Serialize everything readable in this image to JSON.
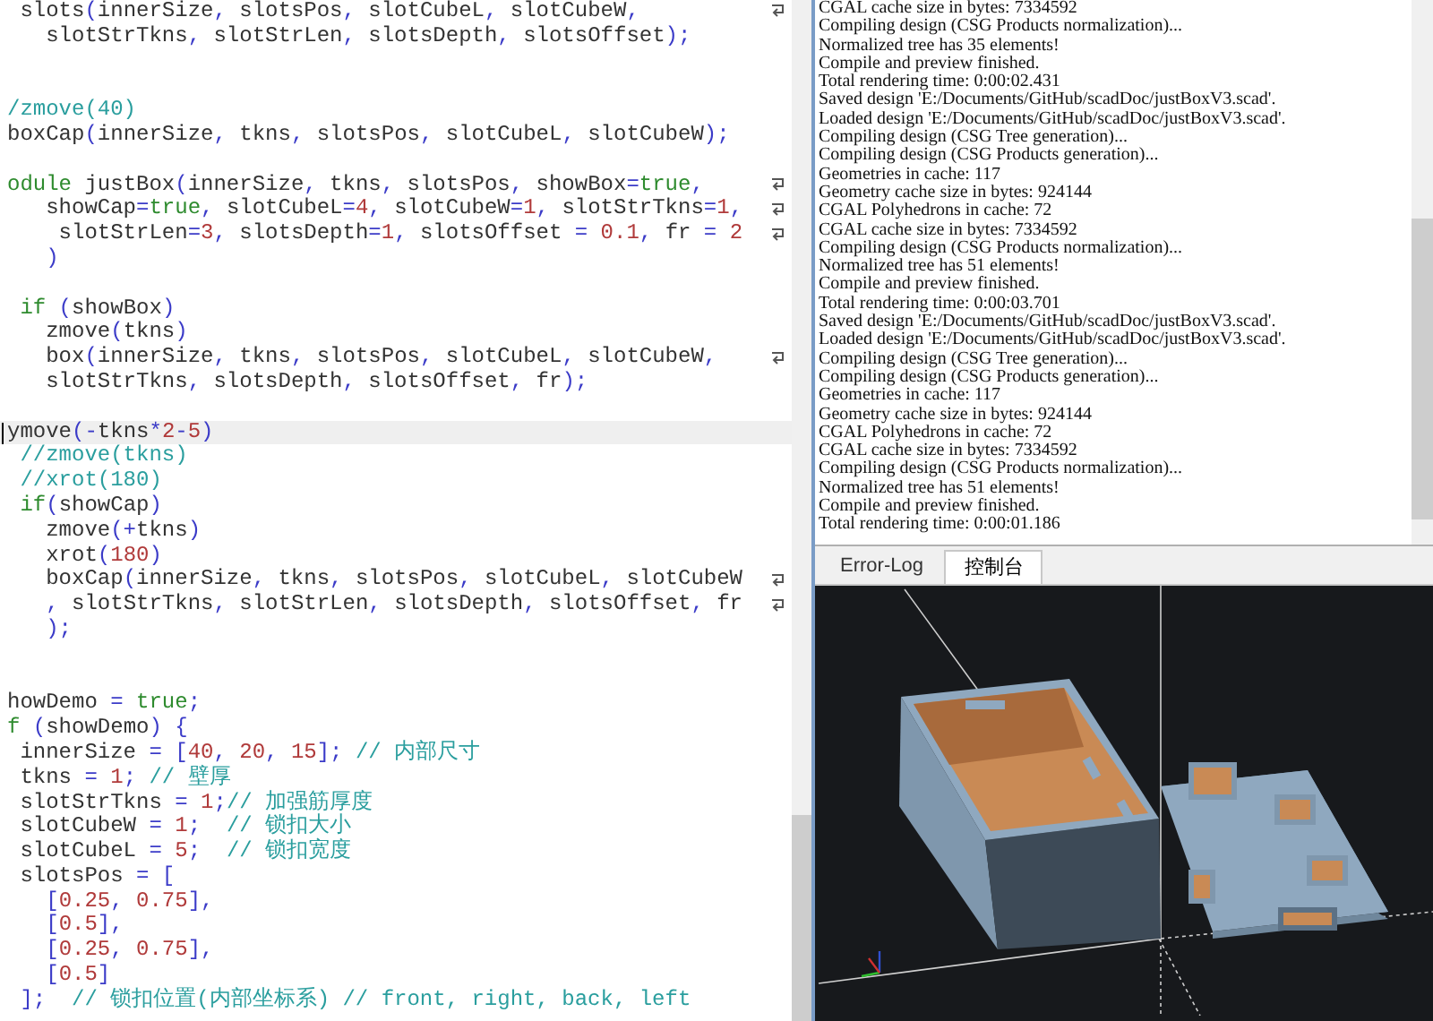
{
  "editor": {
    "lines": [
      {
        "wrapped": true,
        "current": false,
        "segs": [
          {
            "kind": "t",
            "text": " slots"
          },
          {
            "kind": "p",
            "text": "("
          },
          {
            "kind": "t",
            "text": "innerSize"
          },
          {
            "kind": "p",
            "text": ", "
          },
          {
            "kind": "t",
            "text": "slotsPos"
          },
          {
            "kind": "p",
            "text": ", "
          },
          {
            "kind": "t",
            "text": "slotCubeL"
          },
          {
            "kind": "p",
            "text": ", "
          },
          {
            "kind": "t",
            "text": "slotCubeW"
          },
          {
            "kind": "p",
            "text": ","
          }
        ]
      },
      {
        "wrapped": false,
        "current": false,
        "segs": [
          {
            "kind": "t",
            "text": "   slotStrTkns"
          },
          {
            "kind": "p",
            "text": ", "
          },
          {
            "kind": "t",
            "text": "slotStrLen"
          },
          {
            "kind": "p",
            "text": ", "
          },
          {
            "kind": "t",
            "text": "slotsDepth"
          },
          {
            "kind": "p",
            "text": ", "
          },
          {
            "kind": "t",
            "text": "slotsOffset"
          },
          {
            "kind": "p",
            "text": ");"
          }
        ]
      },
      {
        "wrapped": false,
        "current": false
      },
      {
        "wrapped": false,
        "current": false
      },
      {
        "wrapped": false,
        "current": false,
        "segs": [
          {
            "kind": "c",
            "text": "/zmove(40)"
          }
        ]
      },
      {
        "wrapped": false,
        "current": false,
        "segs": [
          {
            "kind": "t",
            "text": "boxCap"
          },
          {
            "kind": "p",
            "text": "("
          },
          {
            "kind": "t",
            "text": "innerSize"
          },
          {
            "kind": "p",
            "text": ", "
          },
          {
            "kind": "t",
            "text": "tkns"
          },
          {
            "kind": "p",
            "text": ", "
          },
          {
            "kind": "t",
            "text": "slotsPos"
          },
          {
            "kind": "p",
            "text": ", "
          },
          {
            "kind": "t",
            "text": "slotCubeL"
          },
          {
            "kind": "p",
            "text": ", "
          },
          {
            "kind": "t",
            "text": "slotCubeW"
          },
          {
            "kind": "p",
            "text": ");"
          }
        ]
      },
      {
        "wrapped": false,
        "current": false
      },
      {
        "wrapped": true,
        "current": false,
        "segs": [
          {
            "kind": "k",
            "text": "odule"
          },
          {
            "kind": "t",
            "text": " justBox"
          },
          {
            "kind": "p",
            "text": "("
          },
          {
            "kind": "t",
            "text": "innerSize"
          },
          {
            "kind": "p",
            "text": ", "
          },
          {
            "kind": "t",
            "text": "tkns"
          },
          {
            "kind": "p",
            "text": ", "
          },
          {
            "kind": "t",
            "text": "slotsPos"
          },
          {
            "kind": "p",
            "text": ", "
          },
          {
            "kind": "t",
            "text": "showBox"
          },
          {
            "kind": "p",
            "text": "="
          },
          {
            "kind": "k",
            "text": "true"
          },
          {
            "kind": "p",
            "text": ","
          }
        ]
      },
      {
        "wrapped": true,
        "current": false,
        "segs": [
          {
            "kind": "t",
            "text": "   showCap"
          },
          {
            "kind": "p",
            "text": "="
          },
          {
            "kind": "k",
            "text": "true"
          },
          {
            "kind": "p",
            "text": ", "
          },
          {
            "kind": "t",
            "text": "slotCubeL"
          },
          {
            "kind": "p",
            "text": "="
          },
          {
            "kind": "n",
            "text": "4"
          },
          {
            "kind": "p",
            "text": ", "
          },
          {
            "kind": "t",
            "text": "slotCubeW"
          },
          {
            "kind": "p",
            "text": "="
          },
          {
            "kind": "n",
            "text": "1"
          },
          {
            "kind": "p",
            "text": ", "
          },
          {
            "kind": "t",
            "text": "slotStrTkns"
          },
          {
            "kind": "p",
            "text": "="
          },
          {
            "kind": "n",
            "text": "1"
          },
          {
            "kind": "p",
            "text": ","
          }
        ]
      },
      {
        "wrapped": true,
        "current": false,
        "segs": [
          {
            "kind": "t",
            "text": "    slotStrLen"
          },
          {
            "kind": "p",
            "text": "="
          },
          {
            "kind": "n",
            "text": "3"
          },
          {
            "kind": "p",
            "text": ", "
          },
          {
            "kind": "t",
            "text": "slotsDepth"
          },
          {
            "kind": "p",
            "text": "="
          },
          {
            "kind": "n",
            "text": "1"
          },
          {
            "kind": "p",
            "text": ", "
          },
          {
            "kind": "t",
            "text": "slotsOffset "
          },
          {
            "kind": "p",
            "text": "= "
          },
          {
            "kind": "n",
            "text": "0.1"
          },
          {
            "kind": "p",
            "text": ", "
          },
          {
            "kind": "t",
            "text": "fr "
          },
          {
            "kind": "p",
            "text": "= "
          },
          {
            "kind": "n",
            "text": "2"
          }
        ]
      },
      {
        "wrapped": false,
        "current": false,
        "segs": [
          {
            "kind": "p",
            "text": "   )"
          }
        ]
      },
      {
        "wrapped": false,
        "current": false
      },
      {
        "wrapped": false,
        "current": false,
        "segs": [
          {
            "kind": "k",
            "text": " if"
          },
          {
            "kind": "p",
            "text": " ("
          },
          {
            "kind": "t",
            "text": "showBox"
          },
          {
            "kind": "p",
            "text": ")"
          }
        ]
      },
      {
        "wrapped": false,
        "current": false,
        "segs": [
          {
            "kind": "t",
            "text": "   zmove"
          },
          {
            "kind": "p",
            "text": "("
          },
          {
            "kind": "t",
            "text": "tkns"
          },
          {
            "kind": "p",
            "text": ")"
          }
        ]
      },
      {
        "wrapped": true,
        "current": false,
        "segs": [
          {
            "kind": "t",
            "text": "   box"
          },
          {
            "kind": "p",
            "text": "("
          },
          {
            "kind": "t",
            "text": "innerSize"
          },
          {
            "kind": "p",
            "text": ", "
          },
          {
            "kind": "t",
            "text": "tkns"
          },
          {
            "kind": "p",
            "text": ", "
          },
          {
            "kind": "t",
            "text": "slotsPos"
          },
          {
            "kind": "p",
            "text": ", "
          },
          {
            "kind": "t",
            "text": "slotCubeL"
          },
          {
            "kind": "p",
            "text": ", "
          },
          {
            "kind": "t",
            "text": "slotCubeW"
          },
          {
            "kind": "p",
            "text": ","
          }
        ]
      },
      {
        "wrapped": false,
        "current": false,
        "segs": [
          {
            "kind": "t",
            "text": "   slotStrTkns"
          },
          {
            "kind": "p",
            "text": ", "
          },
          {
            "kind": "t",
            "text": "slotsDepth"
          },
          {
            "kind": "p",
            "text": ", "
          },
          {
            "kind": "t",
            "text": "slotsOffset"
          },
          {
            "kind": "p",
            "text": ", "
          },
          {
            "kind": "t",
            "text": "fr"
          },
          {
            "kind": "p",
            "text": ");"
          }
        ]
      },
      {
        "wrapped": false,
        "current": false
      },
      {
        "wrapped": false,
        "current": true,
        "segs": [
          {
            "kind": "t",
            "text": "ymove"
          },
          {
            "kind": "p",
            "text": "(-"
          },
          {
            "kind": "t",
            "text": "tkns"
          },
          {
            "kind": "p",
            "text": "*"
          },
          {
            "kind": "n",
            "text": "2"
          },
          {
            "kind": "p",
            "text": "-"
          },
          {
            "kind": "n",
            "text": "5"
          },
          {
            "kind": "p",
            "text": ")"
          }
        ]
      },
      {
        "wrapped": false,
        "current": false,
        "segs": [
          {
            "kind": "c",
            "text": " //zmove(tkns)"
          }
        ]
      },
      {
        "wrapped": false,
        "current": false,
        "segs": [
          {
            "kind": "c",
            "text": " //xrot(180)"
          }
        ]
      },
      {
        "wrapped": false,
        "current": false,
        "segs": [
          {
            "kind": "k",
            "text": " if"
          },
          {
            "kind": "p",
            "text": "("
          },
          {
            "kind": "t",
            "text": "showCap"
          },
          {
            "kind": "p",
            "text": ")"
          }
        ]
      },
      {
        "wrapped": false,
        "current": false,
        "segs": [
          {
            "kind": "t",
            "text": "   zmove"
          },
          {
            "kind": "p",
            "text": "(+"
          },
          {
            "kind": "t",
            "text": "tkns"
          },
          {
            "kind": "p",
            "text": ")"
          }
        ]
      },
      {
        "wrapped": false,
        "current": false,
        "segs": [
          {
            "kind": "t",
            "text": "   xrot"
          },
          {
            "kind": "p",
            "text": "("
          },
          {
            "kind": "n",
            "text": "180"
          },
          {
            "kind": "p",
            "text": ")"
          }
        ]
      },
      {
        "wrapped": true,
        "current": false,
        "segs": [
          {
            "kind": "t",
            "text": "   boxCap"
          },
          {
            "kind": "p",
            "text": "("
          },
          {
            "kind": "t",
            "text": "innerSize"
          },
          {
            "kind": "p",
            "text": ", "
          },
          {
            "kind": "t",
            "text": "tkns"
          },
          {
            "kind": "p",
            "text": ", "
          },
          {
            "kind": "t",
            "text": "slotsPos"
          },
          {
            "kind": "p",
            "text": ", "
          },
          {
            "kind": "t",
            "text": "slotCubeL"
          },
          {
            "kind": "p",
            "text": ", "
          },
          {
            "kind": "t",
            "text": "slotCubeW"
          }
        ]
      },
      {
        "wrapped": true,
        "current": false,
        "segs": [
          {
            "kind": "p",
            "text": "   , "
          },
          {
            "kind": "t",
            "text": "slotStrTkns"
          },
          {
            "kind": "p",
            "text": ", "
          },
          {
            "kind": "t",
            "text": "slotStrLen"
          },
          {
            "kind": "p",
            "text": ", "
          },
          {
            "kind": "t",
            "text": "slotsDepth"
          },
          {
            "kind": "p",
            "text": ", "
          },
          {
            "kind": "t",
            "text": "slotsOffset"
          },
          {
            "kind": "p",
            "text": ", "
          },
          {
            "kind": "t",
            "text": "fr"
          }
        ]
      },
      {
        "wrapped": false,
        "current": false,
        "segs": [
          {
            "kind": "p",
            "text": "   );"
          }
        ]
      },
      {
        "wrapped": false,
        "current": false
      },
      {
        "wrapped": false,
        "current": false
      },
      {
        "wrapped": false,
        "current": false,
        "segs": [
          {
            "kind": "t",
            "text": "howDemo "
          },
          {
            "kind": "p",
            "text": "= "
          },
          {
            "kind": "k",
            "text": "true"
          },
          {
            "kind": "p",
            "text": ";"
          }
        ]
      },
      {
        "wrapped": false,
        "current": false,
        "segs": [
          {
            "kind": "k",
            "text": "f"
          },
          {
            "kind": "p",
            "text": " ("
          },
          {
            "kind": "t",
            "text": "showDemo"
          },
          {
            "kind": "p",
            "text": ") {"
          }
        ]
      },
      {
        "wrapped": false,
        "current": false,
        "segs": [
          {
            "kind": "t",
            "text": " innerSize "
          },
          {
            "kind": "p",
            "text": "= ["
          },
          {
            "kind": "n",
            "text": "40"
          },
          {
            "kind": "p",
            "text": ", "
          },
          {
            "kind": "n",
            "text": "20"
          },
          {
            "kind": "p",
            "text": ", "
          },
          {
            "kind": "n",
            "text": "15"
          },
          {
            "kind": "p",
            "text": "]; "
          },
          {
            "kind": "c",
            "text": "// 内部尺寸"
          }
        ]
      },
      {
        "wrapped": false,
        "current": false,
        "segs": [
          {
            "kind": "t",
            "text": " tkns "
          },
          {
            "kind": "p",
            "text": "= "
          },
          {
            "kind": "n",
            "text": "1"
          },
          {
            "kind": "p",
            "text": "; "
          },
          {
            "kind": "c",
            "text": "// 壁厚"
          }
        ]
      },
      {
        "wrapped": false,
        "current": false,
        "segs": [
          {
            "kind": "t",
            "text": " slotStrTkns "
          },
          {
            "kind": "p",
            "text": "= "
          },
          {
            "kind": "n",
            "text": "1"
          },
          {
            "kind": "p",
            "text": ";"
          },
          {
            "kind": "c",
            "text": "// 加强筋厚度"
          }
        ]
      },
      {
        "wrapped": false,
        "current": false,
        "segs": [
          {
            "kind": "t",
            "text": " slotCubeW "
          },
          {
            "kind": "p",
            "text": "= "
          },
          {
            "kind": "n",
            "text": "1"
          },
          {
            "kind": "p",
            "text": ";  "
          },
          {
            "kind": "c",
            "text": "// 锁扣大小"
          }
        ]
      },
      {
        "wrapped": false,
        "current": false,
        "segs": [
          {
            "kind": "t",
            "text": " slotCubeL "
          },
          {
            "kind": "p",
            "text": "= "
          },
          {
            "kind": "n",
            "text": "5"
          },
          {
            "kind": "p",
            "text": ";  "
          },
          {
            "kind": "c",
            "text": "// 锁扣宽度"
          }
        ]
      },
      {
        "wrapped": false,
        "current": false,
        "segs": [
          {
            "kind": "t",
            "text": " slotsPos "
          },
          {
            "kind": "p",
            "text": "= ["
          }
        ]
      },
      {
        "wrapped": false,
        "current": false,
        "segs": [
          {
            "kind": "p",
            "text": "   ["
          },
          {
            "kind": "n",
            "text": "0.25"
          },
          {
            "kind": "p",
            "text": ", "
          },
          {
            "kind": "n",
            "text": "0.75"
          },
          {
            "kind": "p",
            "text": "],"
          }
        ]
      },
      {
        "wrapped": false,
        "current": false,
        "segs": [
          {
            "kind": "p",
            "text": "   ["
          },
          {
            "kind": "n",
            "text": "0.5"
          },
          {
            "kind": "p",
            "text": "],"
          }
        ]
      },
      {
        "wrapped": false,
        "current": false,
        "segs": [
          {
            "kind": "p",
            "text": "   ["
          },
          {
            "kind": "n",
            "text": "0.25"
          },
          {
            "kind": "p",
            "text": ", "
          },
          {
            "kind": "n",
            "text": "0.75"
          },
          {
            "kind": "p",
            "text": "],"
          }
        ]
      },
      {
        "wrapped": false,
        "current": false,
        "segs": [
          {
            "kind": "p",
            "text": "   ["
          },
          {
            "kind": "n",
            "text": "0.5"
          },
          {
            "kind": "p",
            "text": "]"
          }
        ]
      },
      {
        "wrapped": false,
        "current": false,
        "segs": [
          {
            "kind": "p",
            "text": " ];  "
          },
          {
            "kind": "c",
            "text": "// 锁扣位置(内部坐标系) // front, right, back, left"
          }
        ]
      }
    ]
  },
  "console": {
    "lines": [
      "CGAL cache size in bytes: 7334592",
      "Compiling design (CSG Products normalization)...",
      "Normalized tree has 35 elements!",
      "Compile and preview finished.",
      "Total rendering time: 0:00:02.431",
      "Saved design 'E:/Documents/GitHub/scadDoc/justBoxV3.scad'.",
      "Loaded design 'E:/Documents/GitHub/scadDoc/justBoxV3.scad'.",
      "Compiling design (CSG Tree generation)...",
      "Compiling design (CSG Products generation)...",
      "Geometries in cache: 117",
      "Geometry cache size in bytes: 924144",
      "CGAL Polyhedrons in cache: 72",
      "CGAL cache size in bytes: 7334592",
      "Compiling design (CSG Products normalization)...",
      "Normalized tree has 51 elements!",
      "Compile and preview finished.",
      "Total rendering time: 0:00:03.701",
      "Saved design 'E:/Documents/GitHub/scadDoc/justBoxV3.scad'.",
      "Loaded design 'E:/Documents/GitHub/scadDoc/justBoxV3.scad'.",
      "Compiling design (CSG Tree generation)...",
      "Compiling design (CSG Products generation)...",
      "Geometries in cache: 117",
      "Geometry cache size in bytes: 924144",
      "CGAL Polyhedrons in cache: 72",
      "CGAL cache size in bytes: 7334592",
      "Compiling design (CSG Products normalization)...",
      "Normalized tree has 51 elements!",
      "Compile and preview finished.",
      "Total rendering time: 0:00:01.186"
    ]
  },
  "tabs": [
    {
      "label": "Error-Log",
      "selected": false
    },
    {
      "label": "控制台",
      "selected": true
    }
  ]
}
